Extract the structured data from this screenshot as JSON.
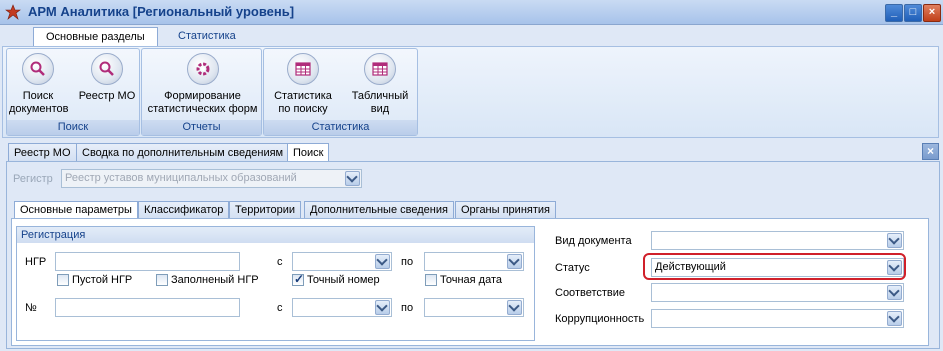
{
  "window": {
    "title": "АРМ Аналитика [Региональный уровень]",
    "minimize": "_",
    "maximize": "□",
    "close": "×"
  },
  "ribbon": {
    "tabs": [
      {
        "label": "Основные разделы"
      },
      {
        "label": "Статистика"
      }
    ],
    "groups": [
      {
        "label": "Поиск",
        "buttons": [
          {
            "label": "Поиск документов",
            "icon": "search-icon"
          },
          {
            "label": "Реестр МО",
            "icon": "search-icon"
          }
        ]
      },
      {
        "label": "Отчеты",
        "buttons": [
          {
            "label": "Формирование статистических форм",
            "icon": "gear-icon"
          }
        ]
      },
      {
        "label": "Статистика",
        "buttons": [
          {
            "label": "Статистика по поиску",
            "icon": "table-icon"
          },
          {
            "label": "Табличный вид",
            "icon": "table-icon"
          }
        ]
      }
    ]
  },
  "doc_tabs": [
    {
      "label": "Реестр МО"
    },
    {
      "label": "Сводка по дополнительным сведениям"
    },
    {
      "label": "Поиск"
    }
  ],
  "register": {
    "label": "Регистр",
    "value": "Реестр уставов муниципальных образований"
  },
  "param_tabs": [
    {
      "label": "Основные параметры"
    },
    {
      "label": "Классификатор"
    },
    {
      "label": "Территории"
    },
    {
      "label": "Дополнительные сведения"
    },
    {
      "label": "Органы принятия"
    }
  ],
  "registration": {
    "title": "Регистрация",
    "ngr_label": "НГР",
    "from_label": "с",
    "to_label": "по",
    "num_label": "№",
    "checkboxes": [
      {
        "label": "Пустой НГР",
        "checked": false
      },
      {
        "label": "Заполненый НГР",
        "checked": false
      },
      {
        "label": "Точный номер",
        "checked": true
      },
      {
        "label": "Точная дата",
        "checked": false
      }
    ]
  },
  "right_fields": [
    {
      "label": "Вид документа",
      "value": ""
    },
    {
      "label": "Статус",
      "value": "Действующий"
    },
    {
      "label": "Соответствие",
      "value": ""
    },
    {
      "label": "Коррупционность",
      "value": ""
    }
  ],
  "colors": {
    "highlight": "#d0202a",
    "accent": "#15428b"
  }
}
